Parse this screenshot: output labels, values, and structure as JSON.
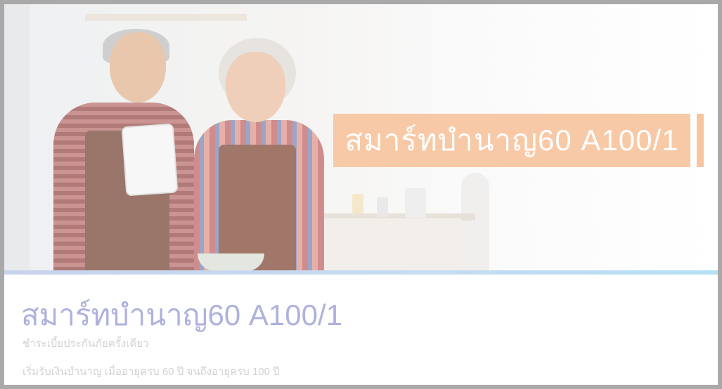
{
  "banner": {
    "label": "สมาร์ทบำนาญ60 A100/1"
  },
  "product": {
    "title": "สมาร์ทบำนาญ60 A100/1",
    "subtitle": "ชำระเบี้ยประกันภัยครั้งเดียว",
    "description": "เริ่มรับเงินบำนาญ เมื่ออายุครบ 60 ปี จนถึงอายุครบ 100 ปี"
  },
  "colors": {
    "banner_bg": "#f8c9a6",
    "title": "#aeb2dc",
    "divider": "#c6dcf1",
    "muted_text": "#d2d2d2"
  }
}
